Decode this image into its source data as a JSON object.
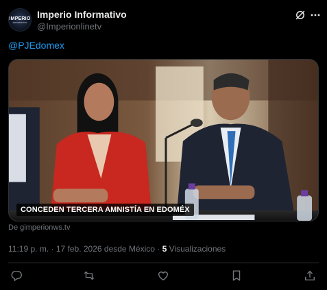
{
  "account": {
    "name": "Imperio Informativo",
    "handle": "@Imperionlinetv",
    "avatar_text": "IMPERIO",
    "avatar_subtext": "INFORMATIVO"
  },
  "tweet": {
    "mention": "@PJEdomex",
    "image_caption": "CONCEDEN TERCERA AMNISTÍA EN EDOMÉX",
    "source": "De gimperionws.tv",
    "time": "11:19 p. m.",
    "separator": "·",
    "date": "17 feb. 2026 desde México",
    "views_count": "5",
    "views_label": "Visualizaciones"
  },
  "icons": {
    "grok": "grok-icon",
    "more": "more-icon",
    "reply": "reply-icon",
    "retweet": "retweet-icon",
    "like": "heart-icon",
    "bookmark": "bookmark-icon",
    "share": "share-icon"
  },
  "colors": {
    "background": "#000000",
    "text": "#e7e9ea",
    "secondary": "#71767b",
    "link": "#1d9bf0",
    "border": "#2f3336"
  }
}
